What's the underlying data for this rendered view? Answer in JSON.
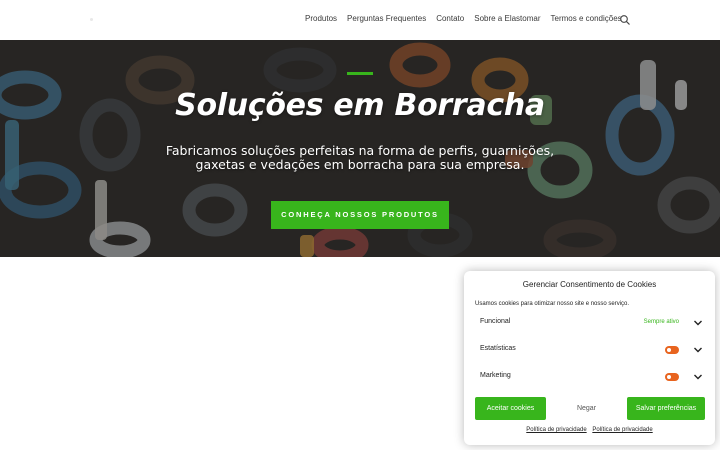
{
  "nav": {
    "items": [
      "Produtos",
      "Perguntas Frequentes",
      "Contato",
      "Sobre a Elastomar",
      "Termos e condições"
    ],
    "search_icon": "search-icon"
  },
  "hero": {
    "title": "Soluções em Borracha",
    "subtitle_line1": "Fabricamos soluções perfeitas na forma de perfis, guarnições,",
    "subtitle_line2": "gaxetas e vedações em borracha para sua empresa.",
    "button_label": "CONHEÇA NOSSOS PRODUTOS",
    "accent_color": "#38b51c"
  },
  "cookie_banner": {
    "title": "Gerenciar Consentimento de Cookies",
    "message": "Usamos cookies para otimizar nosso site e nosso serviço.",
    "categories": [
      {
        "label": "Funcional",
        "status": "Sempre ativo",
        "icon": "chevron-down-icon"
      },
      {
        "label": "Estatísticas",
        "toggle": "off",
        "icon": "chevron-down-icon"
      },
      {
        "label": "Marketing",
        "toggle": "off",
        "icon": "chevron-down-icon"
      }
    ],
    "buttons": {
      "accept": "Aceitar cookies",
      "deny": "Negar",
      "save": "Salvar preferências"
    },
    "links": [
      "Política de privacidade",
      "Política de privacidade"
    ],
    "toggle_color": "#e8641f"
  }
}
